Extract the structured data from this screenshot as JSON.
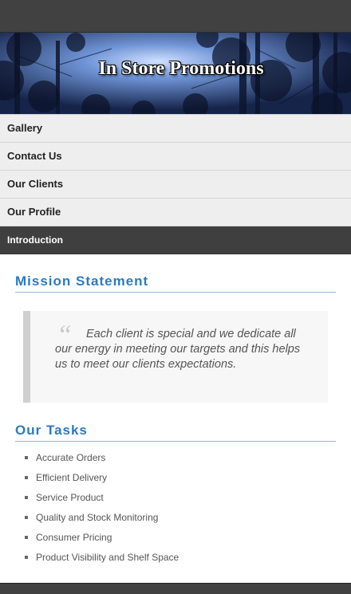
{
  "banner": {
    "title": "In Store Promotions"
  },
  "nav": {
    "items": [
      {
        "label": "Gallery"
      },
      {
        "label": "Contact Us"
      },
      {
        "label": "Our Clients"
      },
      {
        "label": "Our Profile"
      },
      {
        "label": "Introduction"
      }
    ],
    "active": "Introduction"
  },
  "mission": {
    "heading": "Mission Statement",
    "quote": "Each client is special and we dedicate all our energy in meeting our targets and this helps us to meet our clients expectations."
  },
  "tasks": {
    "heading": "Our Tasks",
    "items": [
      "Accurate Orders",
      "Efficient Delivery",
      "Service Product",
      "Quality and Stock Monitoring",
      "Consumer Pricing",
      "Product Visibility and Shelf Space"
    ]
  },
  "colors": {
    "header_bar": "#414141",
    "heading_blue": "#2a7ac4",
    "nav_background": "#eeeeee",
    "nav_active": "#3f3f3f"
  }
}
